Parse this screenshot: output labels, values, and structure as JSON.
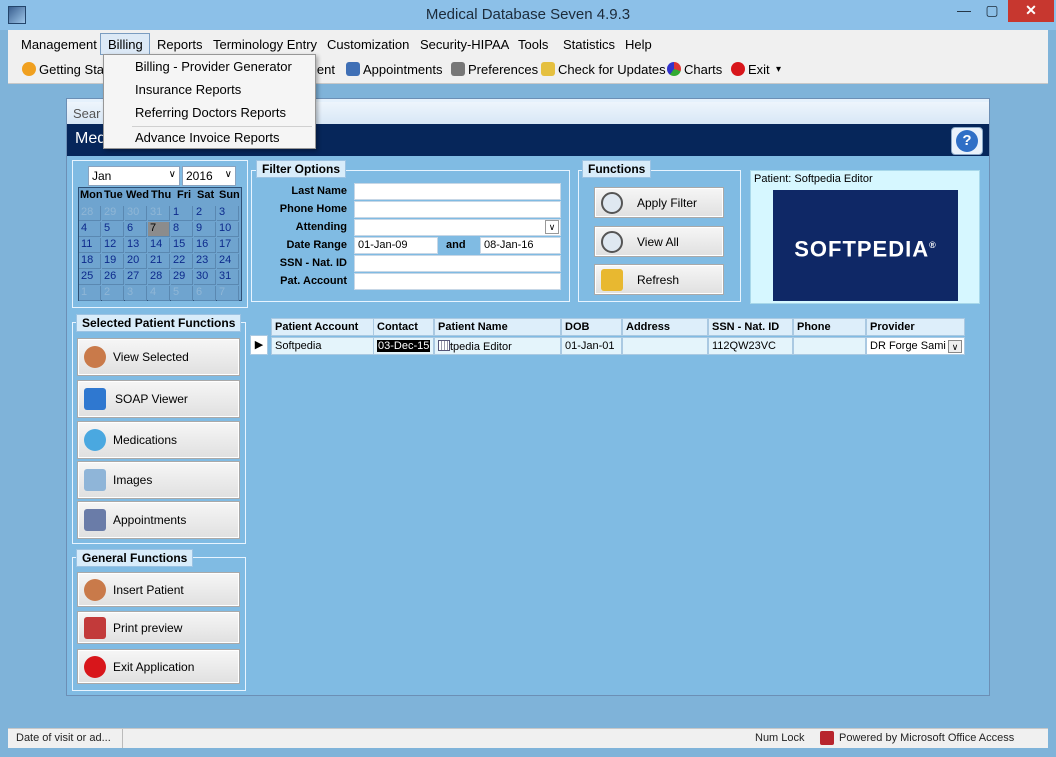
{
  "window": {
    "title": "Medical Database Seven 4.9.3",
    "min": "—",
    "max": "▢",
    "close": "✕"
  },
  "menu": [
    "Management",
    "Billing",
    "Reports",
    "Terminology Entry",
    "Customization",
    "Security-HIPAA",
    "Tools",
    "Statistics",
    "Help"
  ],
  "toolbar": {
    "getting_started": "Getting Star",
    "patient": "ient",
    "appointments": "Appointments",
    "preferences": "Preferences",
    "check_updates": "Check for Updates",
    "charts": "Charts",
    "exit": "Exit",
    "overflow": "▾"
  },
  "billing_menu": [
    "Billing - Provider Generator",
    "Insurance Reports",
    "Referring Doctors Reports",
    "Advance Invoice Reports"
  ],
  "form": {
    "caption": "Sear",
    "header": "Med",
    "help": "?"
  },
  "calendar": {
    "month": "Jan",
    "year": "2016",
    "days": [
      "Mon",
      "Tue",
      "Wed",
      "Thu",
      "Fri",
      "Sat",
      "Sun"
    ],
    "weeks": [
      [
        "28",
        "29",
        "30",
        "31",
        "1",
        "2",
        "3"
      ],
      [
        "4",
        "5",
        "6",
        "7",
        "8",
        "9",
        "10"
      ],
      [
        "11",
        "12",
        "13",
        "14",
        "15",
        "16",
        "17"
      ],
      [
        "18",
        "19",
        "20",
        "21",
        "22",
        "23",
        "24"
      ],
      [
        "25",
        "26",
        "27",
        "28",
        "29",
        "30",
        "31"
      ],
      [
        "1",
        "2",
        "3",
        "4",
        "5",
        "6",
        "7"
      ]
    ],
    "today": "7"
  },
  "filter": {
    "title": "Filter Options",
    "last_name": "Last Name",
    "phone_home": "Phone Home",
    "attending": "Attending",
    "date_range": "Date Range",
    "date_from": "01-Jan-09",
    "and": "and",
    "date_to": "08-Jan-16",
    "ssn": "SSN - Nat. ID",
    "pat_account": "Pat. Account"
  },
  "functions": {
    "title": "Functions",
    "apply_filter": "Apply Filter",
    "view_all": "View All",
    "refresh": "Refresh"
  },
  "patient_panel": {
    "label": "Patient: Softpedia Editor",
    "logo": "SOFTPEDIA",
    "logo_mark": "®"
  },
  "selected_functions": {
    "title": "Selected Patient Functions",
    "view_selected": "View Selected",
    "soap_viewer": "SOAP Viewer",
    "medications": "Medications",
    "images": "Images",
    "appointments": "Appointments"
  },
  "general_functions": {
    "title": "General Functions",
    "insert_patient": "Insert Patient",
    "print_preview": "Print preview",
    "exit_app": "Exit Application"
  },
  "grid": {
    "headers": [
      "Patient Account",
      "Contact",
      "Patient Name",
      "DOB",
      "Address",
      "SSN - Nat. ID",
      "Phone",
      "Provider"
    ],
    "row": {
      "marker": "▶",
      "account": "Softpedia",
      "contact": "03-Dec-15",
      "name": "tpedia Editor",
      "dob": "01-Jan-01",
      "address": "",
      "ssn": "112QW23VC",
      "phone": "",
      "provider": "DR Forge Sami"
    }
  },
  "status": {
    "left": "Date of visit or ad...",
    "numlock": "Num Lock",
    "powered": "Powered by Microsoft Office Access"
  }
}
